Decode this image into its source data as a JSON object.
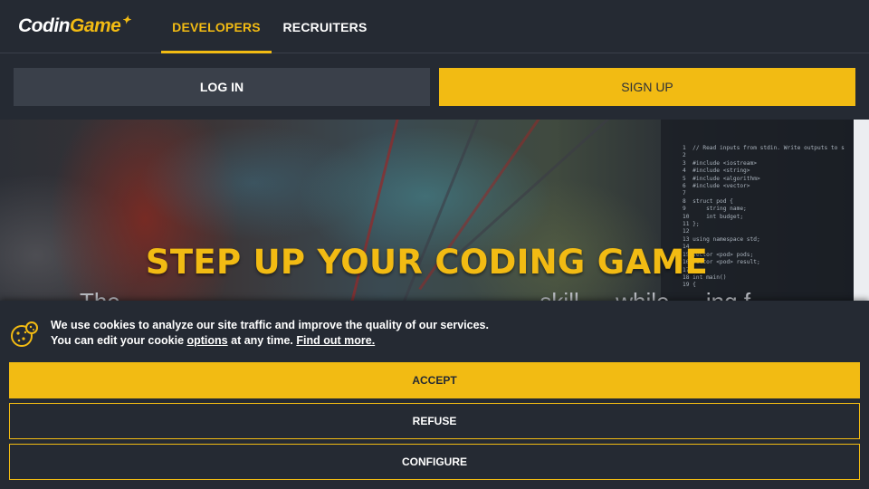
{
  "nav": {
    "logo_part1": "Codin",
    "logo_part2": "Game",
    "tabs": [
      {
        "label": "DEVELOPERS",
        "active": true
      },
      {
        "label": "RECRUITERS",
        "active": false
      }
    ]
  },
  "auth": {
    "login_label": "LOG IN",
    "signup_label": "SIGN UP"
  },
  "hero": {
    "title": "STEP UP YOUR CODING GAME",
    "subtitle": "The …………………………… ……………… skill …  while … ing f…",
    "code_lines": [
      "1  // Read inputs from stdin. Write outputs to s",
      "2",
      "3  #include <iostream>",
      "4  #include <string>",
      "5  #include <algorithm>",
      "6  #include <vector>",
      "7",
      "8  struct pod {",
      "9      string name;",
      "10     int budget;",
      "11 };",
      "12",
      "13 using namespace std;",
      "14",
      "15 vector <pod> pods;",
      "16 vector <pod> result;",
      "17",
      "18 int main()",
      "19 {"
    ]
  },
  "cookie": {
    "line1": "We use cookies to analyze our site traffic and improve the quality of our services.",
    "line2_prefix": "You can edit your cookie ",
    "options_link": "options",
    "line2_middle": " at any time. ",
    "find_out_link": "Find out more.",
    "accept_label": "ACCEPT",
    "refuse_label": "REFUSE",
    "configure_label": "CONFIGURE"
  },
  "colors": {
    "accent": "#f2bb13",
    "background": "#252a33",
    "button_dark": "#3a404a"
  },
  "icons": {
    "cookie": "cookie-icon"
  }
}
